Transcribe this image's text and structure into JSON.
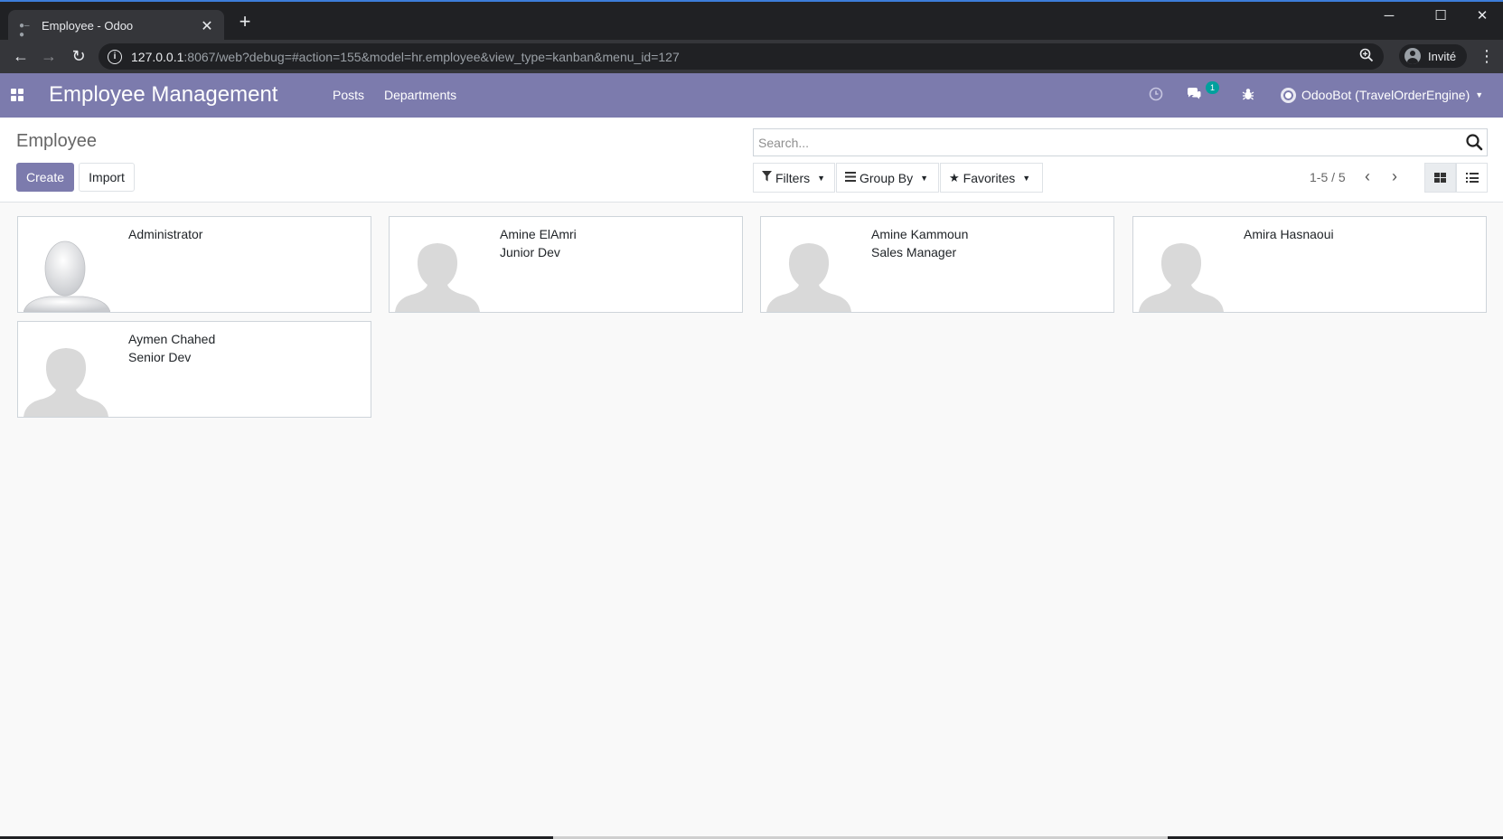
{
  "browser": {
    "tab_title": "Employee - Odoo",
    "tab_close": "✕",
    "new_tab": "+",
    "url_host": "127.0.0.1",
    "url_path": ":8067/web?debug=#action=155&model=hr.employee&view_type=kanban&menu_id=127",
    "profile_label": "Invité",
    "window_controls": {
      "minimize": "─",
      "maximize": "☐",
      "close": "✕"
    }
  },
  "navbar": {
    "app_title": "Employee Management",
    "menu": [
      {
        "label": "Posts"
      },
      {
        "label": "Departments"
      }
    ],
    "messages_count": "1",
    "user": "OdooBot (TravelOrderEngine)"
  },
  "control_panel": {
    "breadcrumb": "Employee",
    "create_label": "Create",
    "import_label": "Import",
    "search_placeholder": "Search...",
    "filters_label": "Filters",
    "groupby_label": "Group By",
    "favorites_label": "Favorites",
    "pager": "1-5 / 5"
  },
  "employees": [
    {
      "name": "Administrator",
      "job": "",
      "photo": "default-avatar"
    },
    {
      "name": "Amine ElAmri",
      "job": "Junior Dev",
      "photo": "placeholder-silhouette"
    },
    {
      "name": "Amine Kammoun",
      "job": "Sales Manager",
      "photo": "placeholder-silhouette"
    },
    {
      "name": "Amira Hasnaoui",
      "job": "",
      "photo": "placeholder-silhouette"
    },
    {
      "name": "Aymen Chahed",
      "job": "Senior Dev",
      "photo": "placeholder-silhouette"
    }
  ],
  "colors": {
    "brand": "#7c7bad",
    "badge": "#00a09d",
    "background": "#f9f9f9"
  }
}
